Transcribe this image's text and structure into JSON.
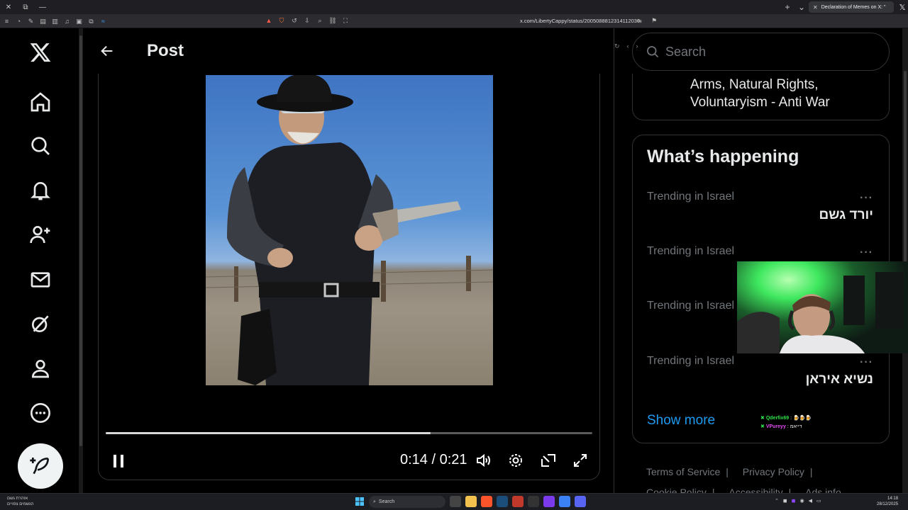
{
  "browser": {
    "tab_title": "Declaration of Memes on X: \"",
    "url": "x.com/LibertyCappy/status/2005088812314112030"
  },
  "header": {
    "title": "Post"
  },
  "video": {
    "current_time": "0:14",
    "duration": "0:21",
    "progress_fraction": 0.667
  },
  "search": {
    "placeholder": "Search"
  },
  "bio": {
    "text": "Arms, Natural Rights, Voluntaryism - Anti War"
  },
  "happening": {
    "title": "What’s happening",
    "trends": [
      {
        "context": "Trending in Israel",
        "topic": "יורד גשם"
      },
      {
        "context": "Trending in Israel",
        "topic": ""
      },
      {
        "context": "Trending in Israel",
        "topic": ""
      },
      {
        "context": "Trending in Israel",
        "topic": "נשיא איראן"
      }
    ],
    "more_glyph": "···",
    "show_more": "Show more"
  },
  "chat": [
    {
      "user": "Qderfix69",
      "message": ": 🍺🍺🍺"
    },
    {
      "user": "VPureyy",
      "message": ": דייאמ"
    }
  ],
  "footer": {
    "links": [
      "Terms of Service",
      "Privacy Policy",
      "Cookie Policy",
      "Accessibility",
      "Ads info"
    ]
  },
  "taskbar": {
    "weather_line1": "אזהרת גשם",
    "weather_line2": "הגשמים צפויים",
    "search_label": "Search",
    "time": "14:18",
    "date": "28/12/2025"
  },
  "colors": {
    "accent": "#1d9bf0",
    "text": "#e7e9ea",
    "muted": "#71767b",
    "border": "#2f3336"
  }
}
